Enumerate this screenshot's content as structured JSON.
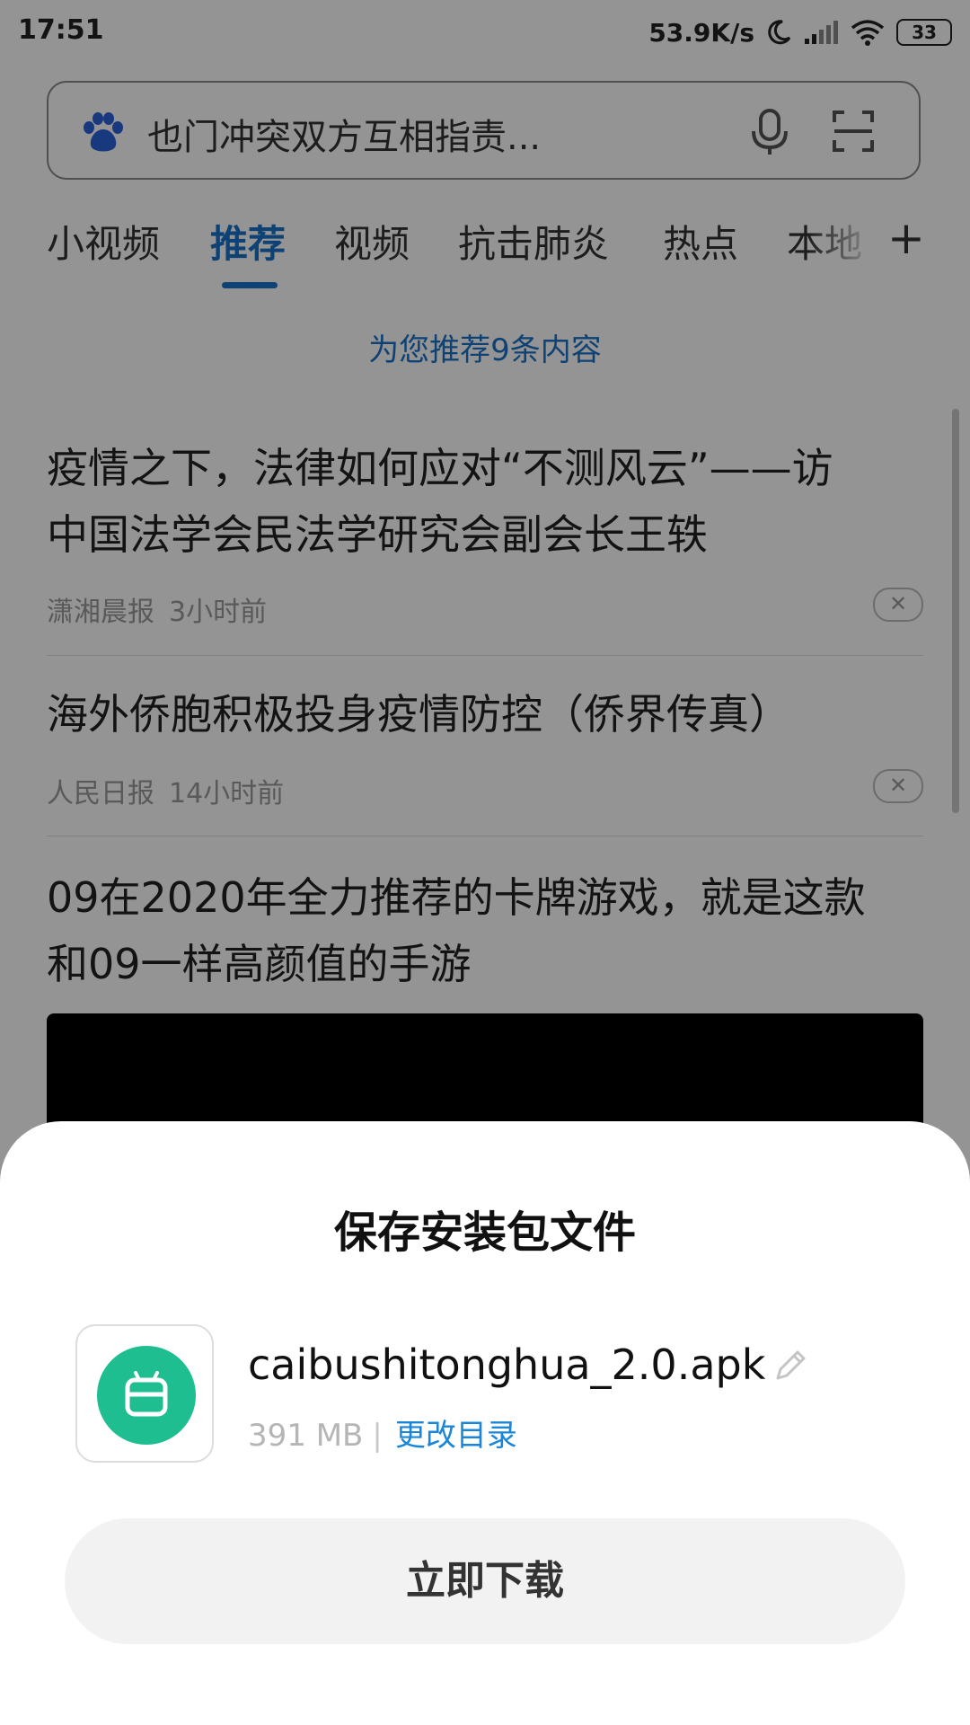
{
  "status_bar": {
    "time": "17:51",
    "net_speed": "53.9K/s",
    "battery": "33",
    "icons": [
      "moon-icon",
      "signal-icon",
      "wifi-icon",
      "battery-icon"
    ]
  },
  "search": {
    "query": "也门冲突双方互相指责...",
    "icons": [
      "baidu-paw-icon",
      "microphone-icon",
      "scan-icon"
    ]
  },
  "tabs": {
    "items": [
      {
        "label": "小视频",
        "active": false
      },
      {
        "label": "推荐",
        "active": true
      },
      {
        "label": "视频",
        "active": false
      },
      {
        "label": "抗击肺炎",
        "active": false
      },
      {
        "label": "热点",
        "active": false
      },
      {
        "label": "本地",
        "active": false
      }
    ],
    "add_label": "+"
  },
  "feed": {
    "notice": "为您推荐9条内容",
    "items": [
      {
        "title_line1": "疫情之下，法律如何应对“不测风云”——访",
        "title_line2": "中国法学会民法学研究会副会长王轶",
        "source": "潇湘晨报",
        "time": "3小时前"
      },
      {
        "title_line1": "海外侨胞积极投身疫情防控（侨界传真）",
        "title_line2": "",
        "source": "人民日报",
        "time": "14小时前"
      },
      {
        "title_line1": "09在2020年全力推荐的卡牌游戏，就是这款",
        "title_line2": "和09一样高颜值的手游",
        "source": "",
        "time": ""
      }
    ],
    "dismiss_glyph": "✕"
  },
  "sheet": {
    "title": "保存安装包文件",
    "file_name": "caibushitonghua_2.0.apk",
    "file_size": "391 MB",
    "separator": "|",
    "change_dir": "更改目录",
    "download_label": "立即下载",
    "accent_color": "#1fbe90",
    "link_color": "#1a86d8"
  }
}
